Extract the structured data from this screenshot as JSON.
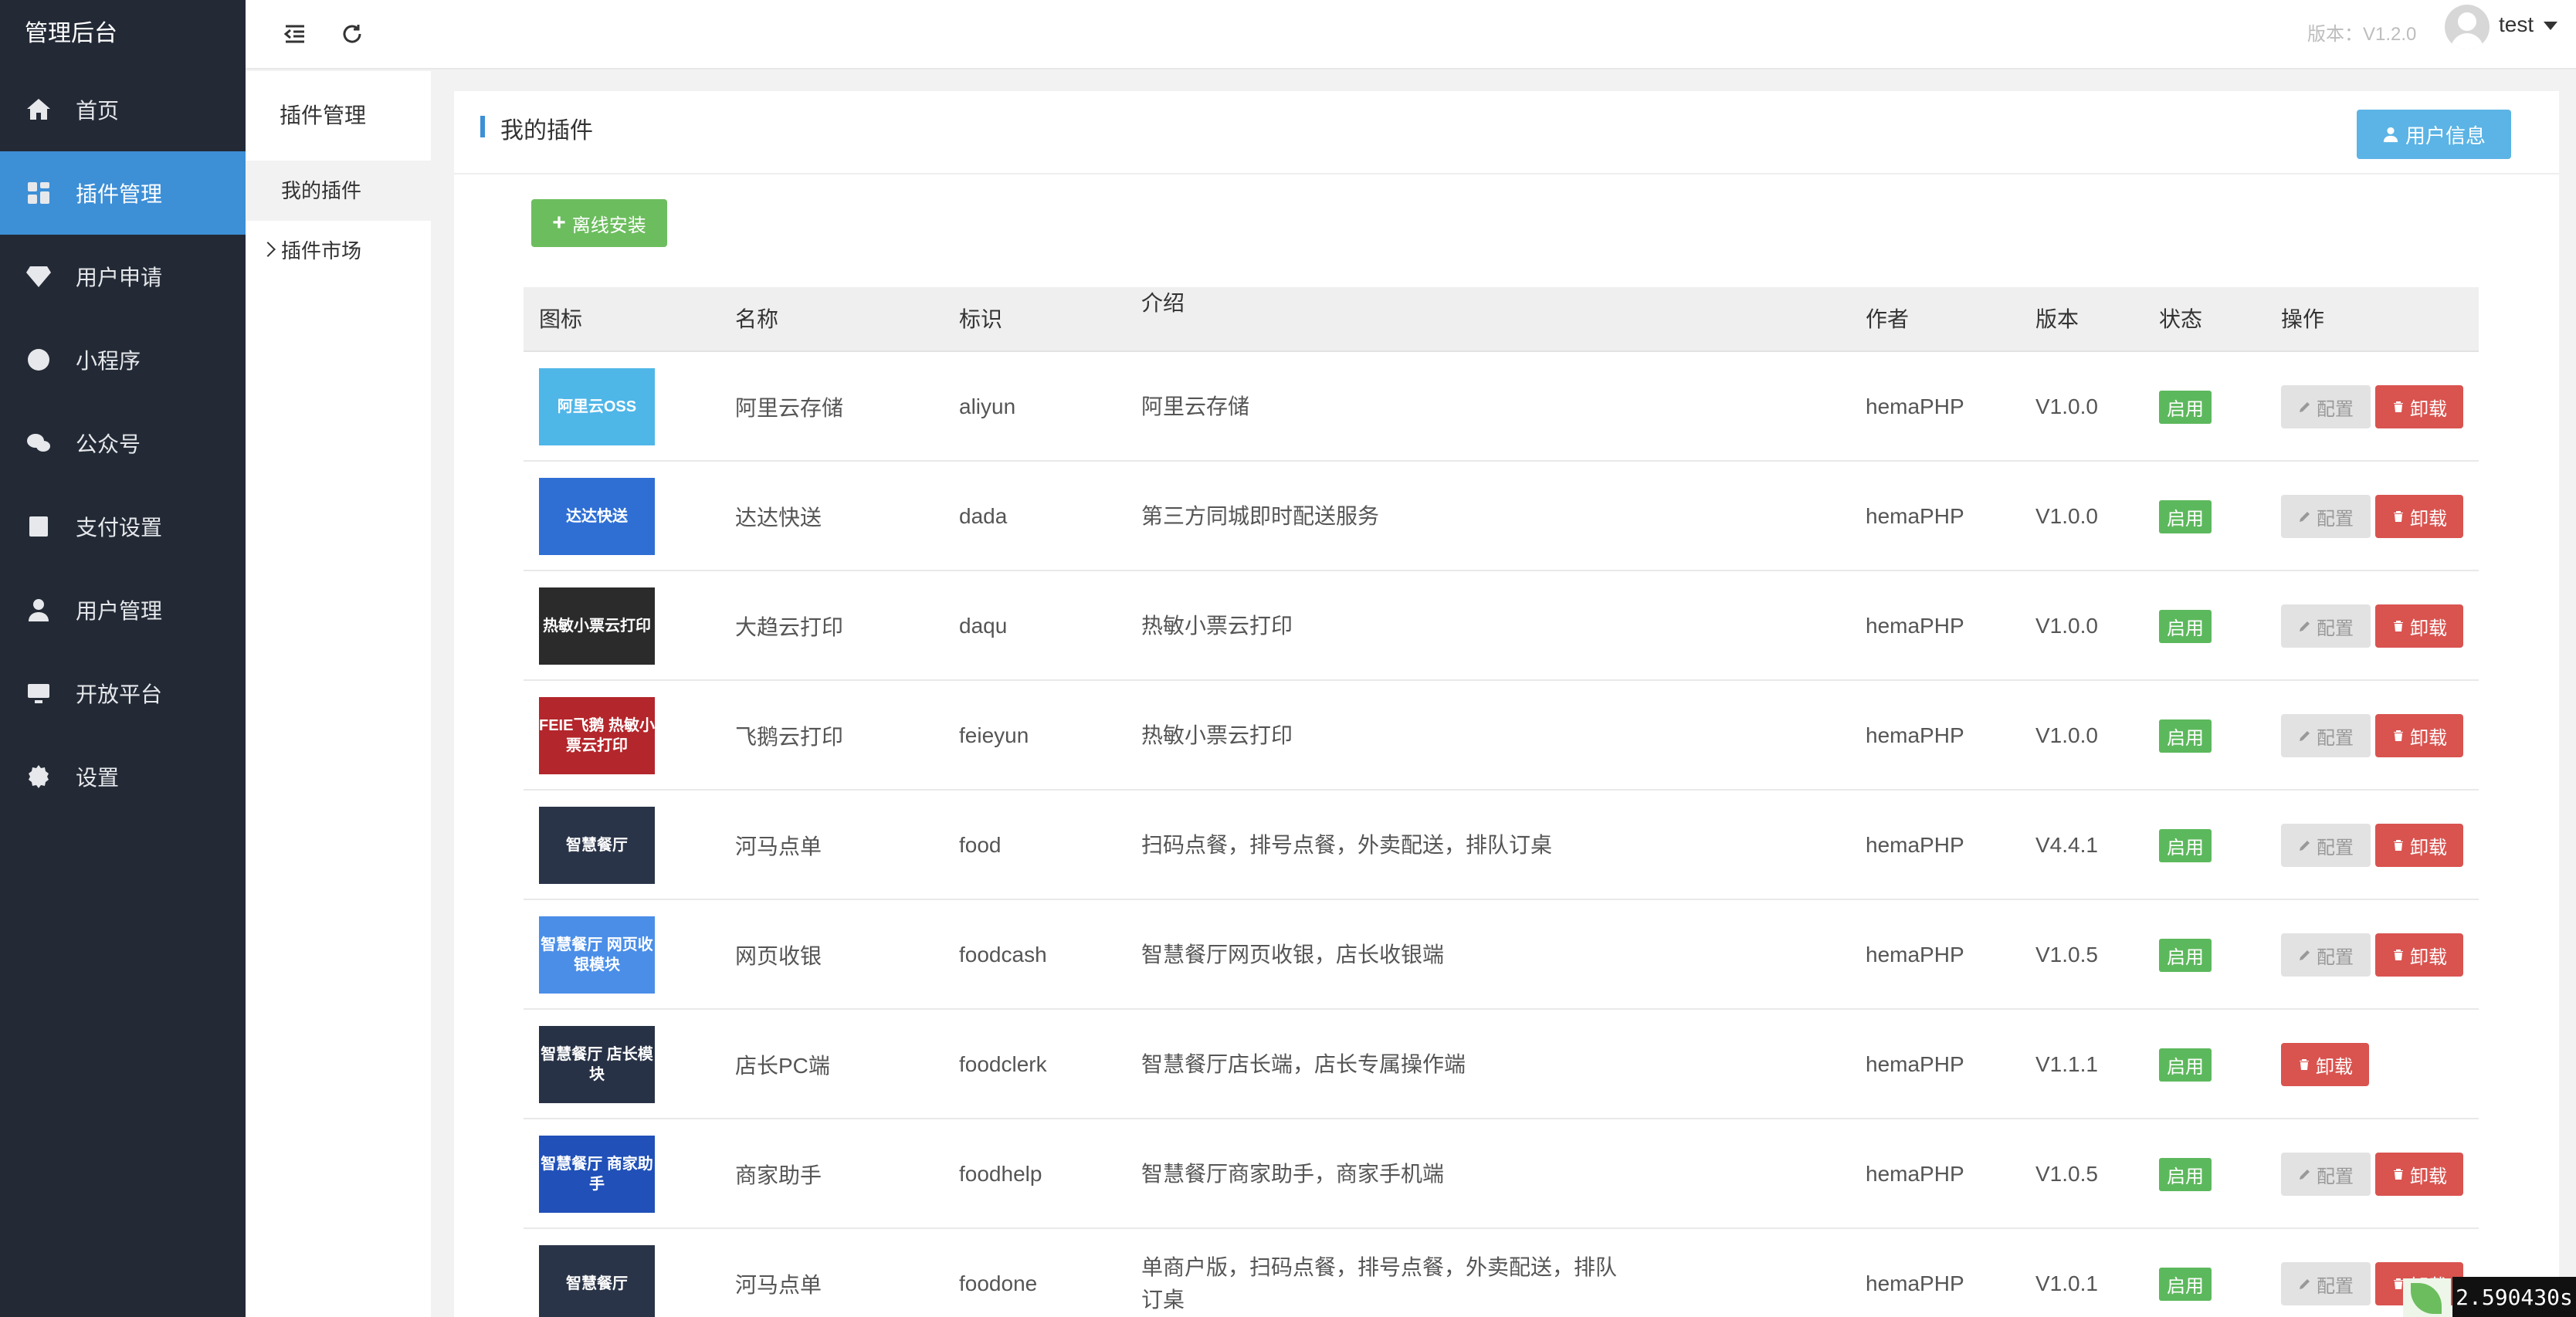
{
  "sidebar": {
    "brand": "管理后台",
    "items": [
      {
        "label": "首页",
        "icon": "home-icon"
      },
      {
        "label": "插件管理",
        "icon": "dashboard-icon"
      },
      {
        "label": "用户申请",
        "icon": "diamond-icon"
      },
      {
        "label": "小程序",
        "icon": "mini-program-icon"
      },
      {
        "label": "公众号",
        "icon": "wechat-icon"
      },
      {
        "label": "支付设置",
        "icon": "payment-icon"
      },
      {
        "label": "用户管理",
        "icon": "user-icon"
      },
      {
        "label": "开放平台",
        "icon": "monitor-icon"
      },
      {
        "label": "设置",
        "icon": "gear-icon"
      }
    ],
    "active_index": 1
  },
  "topbar": {
    "version": "版本：V1.2.0",
    "username": "test"
  },
  "subnav": {
    "title": "插件管理",
    "items": [
      {
        "label": "我的插件"
      },
      {
        "label": "插件市场"
      }
    ]
  },
  "panel": {
    "title": "我的插件",
    "user_info_button": "用户信息",
    "offline_install_button": "离线安装"
  },
  "table": {
    "headers": [
      "图标",
      "名称",
      "标识",
      "介绍",
      "作者",
      "版本",
      "状态",
      "操作"
    ],
    "config_label": "配置",
    "uninstall_label": "卸载",
    "rows": [
      {
        "icon_text": "阿里云OSS",
        "icon_color": "#4fb6e8",
        "name": "阿里云存储",
        "id": "aliyun",
        "desc": "阿里云存储",
        "author": "hemaPHP",
        "version": "V1.0.0",
        "status": "启用"
      },
      {
        "icon_text": "达达快送",
        "icon_color": "#2f6fd4",
        "name": "达达快送",
        "id": "dada",
        "desc": "第三方同城即时配送服务",
        "author": "hemaPHP",
        "version": "V1.0.0",
        "status": "启用"
      },
      {
        "icon_text": "热敏小票云打印",
        "icon_color": "#2b2b2b",
        "name": "大趋云打印",
        "id": "daqu",
        "desc": "热敏小票云打印",
        "author": "hemaPHP",
        "version": "V1.0.0",
        "status": "启用"
      },
      {
        "icon_text": "FEIE飞鹅 热敏小票云打印",
        "icon_color": "#b3262b",
        "name": "飞鹅云打印",
        "id": "feieyun",
        "desc": "热敏小票云打印",
        "author": "hemaPHP",
        "version": "V1.0.0",
        "status": "启用"
      },
      {
        "icon_text": "智慧餐厅",
        "icon_color": "#2a3448",
        "name": "河马点单",
        "id": "food",
        "desc": "扫码点餐，排号点餐，外卖配送，排队订桌",
        "author": "hemaPHP",
        "version": "V4.4.1",
        "status": "启用"
      },
      {
        "icon_text": "智慧餐厅 网页收银模块",
        "icon_color": "#4a8ee8",
        "name": "网页收银",
        "id": "foodcash",
        "desc": "智慧餐厅网页收银，店长收银端",
        "author": "hemaPHP",
        "version": "V1.0.5",
        "status": "启用"
      },
      {
        "icon_text": "智慧餐厅 店长模块",
        "icon_color": "#283246",
        "name": "店长PC端",
        "id": "foodclerk",
        "desc": "智慧餐厅店长端，店长专属操作端",
        "author": "hemaPHP",
        "version": "V1.1.1",
        "status": "启用",
        "no_config": true
      },
      {
        "icon_text": "智慧餐厅 商家助手",
        "icon_color": "#2050b8",
        "name": "商家助手",
        "id": "foodhelp",
        "desc": "智慧餐厅商家助手，商家手机端",
        "author": "hemaPHP",
        "version": "V1.0.5",
        "status": "启用"
      },
      {
        "icon_text": "智慧餐厅",
        "icon_color": "#2a3448",
        "name": "河马点单",
        "id": "foodone",
        "desc": "单商户版，扫码点餐，排号点餐，外卖配送，排队订桌",
        "author": "hemaPHP",
        "version": "V1.0.1",
        "status": "启用"
      }
    ]
  },
  "timer": "2.590430s"
}
